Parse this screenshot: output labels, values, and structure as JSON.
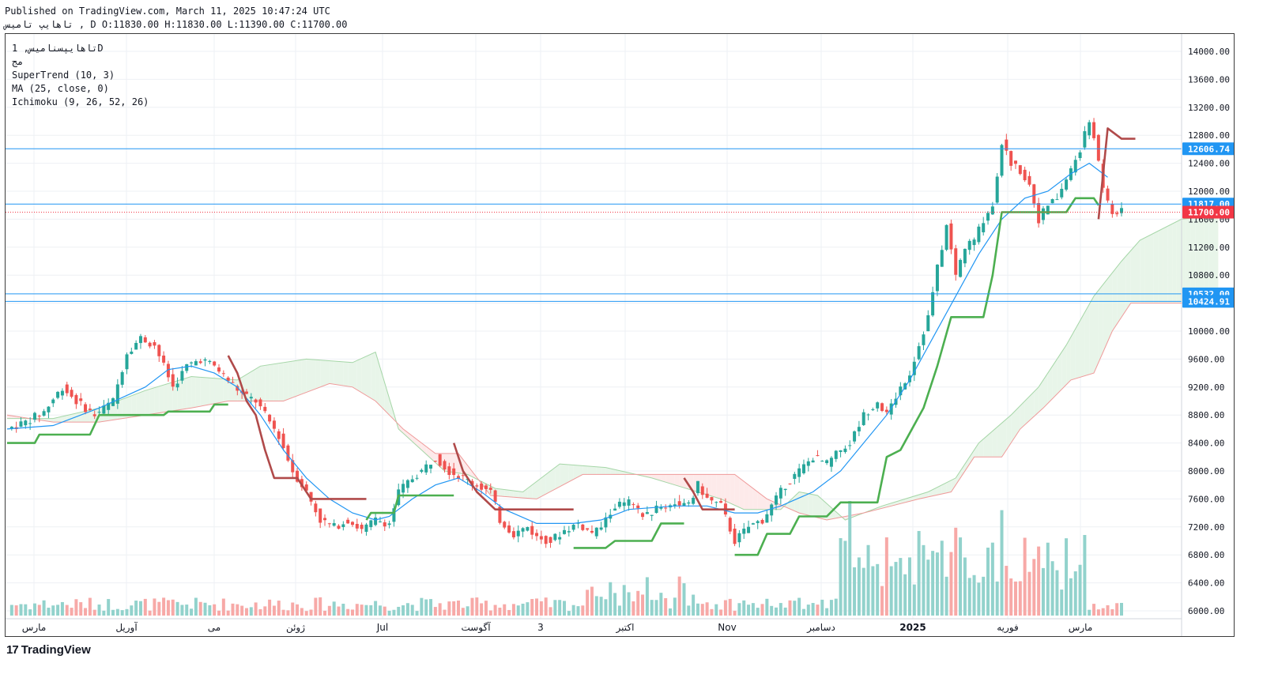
{
  "header": {
    "published": "Published on TradingView.com, March 11, 2025 10:47:24 UTC",
    "ohlc_line": "تاهایپ تامیس , D O:11830.00 H:11830.00 L:11390.00 C:11700.00"
  },
  "legend": {
    "symbol": "تاهایپسنامیس, 1D",
    "subtitle": "مج",
    "supertrend": "SuperTrend (10, 3)",
    "ma": "MA (25, close, 0)",
    "ichimoku": "Ichimoku (9, 26, 52, 26)"
  },
  "footer": {
    "brand": "TradingView",
    "mark": "17"
  },
  "colors": {
    "up": "#26a69a",
    "down": "#ef5350",
    "vol_up": "#92d2cc",
    "vol_down": "#f7a9a7",
    "supertrend_up": "#4caf50",
    "supertrend_down": "#b04a4a",
    "ma": "#2196f3",
    "cloud_bull": "#e8f5e9",
    "cloud_bear": "#fdeaea",
    "hline": "#2196f3",
    "last": "#f23645"
  },
  "chart_data": {
    "type": "candlestick",
    "timeframe": "1D",
    "y_axis": {
      "min": 6000,
      "max": 14000,
      "ticks": [
        14000,
        13600,
        13200,
        12800,
        12400,
        12000,
        11600,
        11200,
        10800,
        10400,
        10000,
        9600,
        9200,
        8800,
        8400,
        8000,
        7600,
        7200,
        6800,
        6400,
        6000
      ]
    },
    "x_axis": {
      "labels": [
        "مارس",
        "آوریل",
        "می",
        "ژوئن",
        "Jul",
        "آگوست",
        "3",
        "اکتبر",
        "Nov",
        "دسامبر",
        "2025",
        "فوریه",
        "مارس"
      ]
    },
    "price_labels": [
      {
        "value": 12606.74,
        "label": "12606.74",
        "kind": "level"
      },
      {
        "value": 11817.0,
        "label": "11817.00",
        "kind": "level"
      },
      {
        "value": 11700.0,
        "label": "11700.00",
        "kind": "last"
      },
      {
        "value": 10532.0,
        "label": "10532.00",
        "kind": "level"
      },
      {
        "value": 10424.91,
        "label": "10424.91",
        "kind": "level"
      }
    ],
    "last_ohlc": {
      "open": 11830.0,
      "high": 11830.0,
      "low": 11390.0,
      "close": 11700.0
    },
    "close_path": [
      [
        0,
        8600
      ],
      [
        8,
        8700
      ],
      [
        16,
        8850
      ],
      [
        24,
        9200
      ],
      [
        30,
        9000
      ],
      [
        38,
        8800
      ],
      [
        46,
        9000
      ],
      [
        52,
        9700
      ],
      [
        58,
        9900
      ],
      [
        64,
        9800
      ],
      [
        72,
        9200
      ],
      [
        78,
        9500
      ],
      [
        84,
        9600
      ],
      [
        90,
        9500
      ],
      [
        96,
        9300
      ],
      [
        102,
        9100
      ],
      [
        108,
        9000
      ],
      [
        112,
        8800
      ],
      [
        118,
        8500
      ],
      [
        124,
        8000
      ],
      [
        130,
        7700
      ],
      [
        136,
        7300
      ],
      [
        142,
        7200
      ],
      [
        148,
        7300
      ],
      [
        154,
        7150
      ],
      [
        160,
        7300
      ],
      [
        166,
        7250
      ],
      [
        170,
        7700
      ],
      [
        176,
        7900
      ],
      [
        180,
        8000
      ],
      [
        186,
        8200
      ],
      [
        192,
        8000
      ],
      [
        198,
        7900
      ],
      [
        204,
        7800
      ],
      [
        210,
        7700
      ],
      [
        214,
        7300
      ],
      [
        220,
        7100
      ],
      [
        226,
        7200
      ],
      [
        230,
        7050
      ],
      [
        236,
        7000
      ],
      [
        242,
        7150
      ],
      [
        248,
        7250
      ],
      [
        254,
        7100
      ],
      [
        258,
        7200
      ],
      [
        264,
        7500
      ],
      [
        270,
        7550
      ],
      [
        276,
        7350
      ],
      [
        282,
        7450
      ],
      [
        290,
        7550
      ],
      [
        296,
        7500
      ],
      [
        300,
        7800
      ],
      [
        304,
        7600
      ],
      [
        310,
        7500
      ],
      [
        316,
        7000
      ],
      [
        322,
        7200
      ],
      [
        328,
        7300
      ],
      [
        334,
        7600
      ],
      [
        338,
        7800
      ],
      [
        344,
        8000
      ],
      [
        350,
        8200
      ],
      [
        356,
        8100
      ],
      [
        362,
        8300
      ],
      [
        366,
        8400
      ],
      [
        372,
        8800
      ],
      [
        378,
        9000
      ],
      [
        382,
        8800
      ],
      [
        388,
        9200
      ],
      [
        392,
        9400
      ],
      [
        396,
        9800
      ],
      [
        400,
        10200
      ],
      [
        404,
        10900
      ],
      [
        408,
        11500
      ],
      [
        412,
        10800
      ],
      [
        416,
        11200
      ],
      [
        420,
        11300
      ],
      [
        424,
        11600
      ],
      [
        428,
        11800
      ],
      [
        432,
        12700
      ],
      [
        436,
        12400
      ],
      [
        440,
        12300
      ],
      [
        444,
        12100
      ],
      [
        448,
        11600
      ],
      [
        452,
        11800
      ],
      [
        456,
        11900
      ],
      [
        462,
        12300
      ],
      [
        466,
        12600
      ],
      [
        470,
        13000
      ],
      [
        472,
        12800
      ],
      [
        476,
        12000
      ],
      [
        480,
        11700
      ],
      [
        484,
        11700
      ]
    ],
    "ma25_path": [
      [
        0,
        8600
      ],
      [
        20,
        8650
      ],
      [
        40,
        8900
      ],
      [
        60,
        9200
      ],
      [
        70,
        9450
      ],
      [
        80,
        9500
      ],
      [
        90,
        9400
      ],
      [
        100,
        9200
      ],
      [
        110,
        8800
      ],
      [
        120,
        8300
      ],
      [
        130,
        7900
      ],
      [
        140,
        7600
      ],
      [
        150,
        7400
      ],
      [
        160,
        7300
      ],
      [
        166,
        7350
      ],
      [
        176,
        7600
      ],
      [
        186,
        7800
      ],
      [
        196,
        7900
      ],
      [
        206,
        7700
      ],
      [
        216,
        7450
      ],
      [
        230,
        7250
      ],
      [
        246,
        7250
      ],
      [
        258,
        7300
      ],
      [
        270,
        7450
      ],
      [
        290,
        7500
      ],
      [
        304,
        7500
      ],
      [
        316,
        7400
      ],
      [
        326,
        7400
      ],
      [
        336,
        7500
      ],
      [
        350,
        7700
      ],
      [
        362,
        8000
      ],
      [
        372,
        8400
      ],
      [
        382,
        8800
      ],
      [
        392,
        9300
      ],
      [
        402,
        9900
      ],
      [
        412,
        10500
      ],
      [
        422,
        11100
      ],
      [
        432,
        11600
      ],
      [
        442,
        11900
      ],
      [
        452,
        12000
      ],
      [
        462,
        12250
      ],
      [
        470,
        12400
      ],
      [
        478,
        12200
      ]
    ],
    "supertrend_segments": [
      {
        "trend": "up",
        "points": [
          [
            0,
            8400
          ],
          [
            12,
            8400
          ],
          [
            14,
            8520
          ],
          [
            36,
            8520
          ],
          [
            40,
            8800
          ],
          [
            68,
            8800
          ],
          [
            70,
            8850
          ],
          [
            88,
            8850
          ],
          [
            90,
            8950
          ],
          [
            96,
            8950
          ]
        ]
      },
      {
        "trend": "down",
        "points": [
          [
            96,
            9650
          ],
          [
            100,
            9400
          ],
          [
            104,
            9000
          ],
          [
            108,
            8800
          ],
          [
            112,
            8300
          ],
          [
            116,
            7900
          ],
          [
            126,
            7900
          ],
          [
            132,
            7600
          ],
          [
            156,
            7600
          ]
        ]
      },
      {
        "trend": "up",
        "points": [
          [
            156,
            7300
          ],
          [
            158,
            7400
          ],
          [
            168,
            7400
          ],
          [
            170,
            7650
          ],
          [
            194,
            7650
          ]
        ]
      },
      {
        "trend": "down",
        "points": [
          [
            194,
            8400
          ],
          [
            198,
            8000
          ],
          [
            204,
            7700
          ],
          [
            212,
            7450
          ],
          [
            246,
            7450
          ]
        ]
      },
      {
        "trend": "up",
        "points": [
          [
            246,
            6900
          ],
          [
            260,
            6900
          ],
          [
            264,
            7000
          ],
          [
            280,
            7000
          ],
          [
            284,
            7250
          ],
          [
            294,
            7250
          ]
        ]
      },
      {
        "trend": "down",
        "points": [
          [
            294,
            7900
          ],
          [
            298,
            7700
          ],
          [
            302,
            7450
          ],
          [
            316,
            7450
          ]
        ]
      },
      {
        "trend": "up",
        "points": [
          [
            316,
            6800
          ],
          [
            326,
            6800
          ],
          [
            330,
            7100
          ],
          [
            340,
            7100
          ],
          [
            344,
            7350
          ],
          [
            356,
            7350
          ],
          [
            362,
            7550
          ],
          [
            378,
            7550
          ],
          [
            382,
            8200
          ],
          [
            388,
            8300
          ],
          [
            398,
            8900
          ],
          [
            404,
            9500
          ],
          [
            410,
            10200
          ],
          [
            424,
            10200
          ],
          [
            428,
            10800
          ],
          [
            432,
            11700
          ],
          [
            460,
            11700
          ],
          [
            464,
            11900
          ],
          [
            472,
            11900
          ],
          [
            474,
            11800
          ]
        ]
      },
      {
        "trend": "down",
        "points": [
          [
            474,
            11600
          ],
          [
            478,
            12900
          ],
          [
            484,
            12750
          ],
          [
            490,
            12750
          ]
        ]
      }
    ],
    "ichimoku_span_a": [
      [
        0,
        8750
      ],
      [
        20,
        8750
      ],
      [
        40,
        8900
      ],
      [
        60,
        9150
      ],
      [
        80,
        9350
      ],
      [
        100,
        9300
      ],
      [
        110,
        9500
      ],
      [
        130,
        9600
      ],
      [
        150,
        9550
      ],
      [
        160,
        9700
      ],
      [
        170,
        8600
      ],
      [
        180,
        8300
      ],
      [
        190,
        8000
      ],
      [
        200,
        7950
      ],
      [
        212,
        7750
      ],
      [
        224,
        7700
      ],
      [
        240,
        8100
      ],
      [
        260,
        8050
      ],
      [
        280,
        7900
      ],
      [
        290,
        7800
      ],
      [
        310,
        7600
      ],
      [
        320,
        7450
      ],
      [
        336,
        7450
      ],
      [
        344,
        7700
      ],
      [
        352,
        7650
      ],
      [
        364,
        7300
      ],
      [
        380,
        7500
      ],
      [
        400,
        7700
      ],
      [
        412,
        7900
      ],
      [
        422,
        8400
      ],
      [
        436,
        8800
      ],
      [
        448,
        9200
      ],
      [
        460,
        9800
      ],
      [
        472,
        10500
      ],
      [
        484,
        11000
      ],
      [
        492,
        11300
      ],
      [
        510,
        11600
      ],
      [
        525,
        11650
      ]
    ],
    "ichimoku_span_b": [
      [
        0,
        8800
      ],
      [
        20,
        8700
      ],
      [
        40,
        8700
      ],
      [
        60,
        8800
      ],
      [
        80,
        8900
      ],
      [
        96,
        9000
      ],
      [
        120,
        9000
      ],
      [
        140,
        9250
      ],
      [
        150,
        9200
      ],
      [
        160,
        9000
      ],
      [
        172,
        8600
      ],
      [
        186,
        8250
      ],
      [
        196,
        8250
      ],
      [
        210,
        7650
      ],
      [
        230,
        7600
      ],
      [
        250,
        7950
      ],
      [
        270,
        7950
      ],
      [
        300,
        7950
      ],
      [
        316,
        7950
      ],
      [
        330,
        7600
      ],
      [
        344,
        7400
      ],
      [
        356,
        7300
      ],
      [
        372,
        7400
      ],
      [
        384,
        7500
      ],
      [
        396,
        7600
      ],
      [
        410,
        7700
      ],
      [
        420,
        8200
      ],
      [
        432,
        8200
      ],
      [
        440,
        8600
      ],
      [
        450,
        8900
      ],
      [
        462,
        9300
      ],
      [
        472,
        9400
      ],
      [
        480,
        10000
      ],
      [
        488,
        10400
      ],
      [
        520,
        10400
      ],
      [
        525,
        10400
      ]
    ],
    "level_lines": [
      12606.74,
      11817.0,
      10532.0,
      10424.91
    ],
    "volume_scale": {
      "max": 1000
    }
  }
}
